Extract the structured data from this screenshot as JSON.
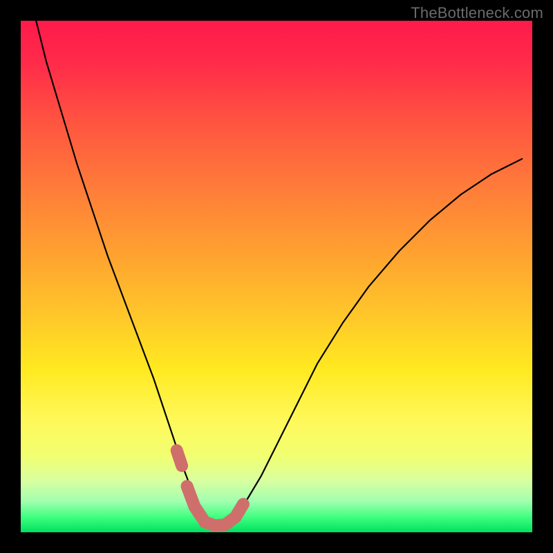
{
  "watermark": "TheBottleneck.com",
  "colors": {
    "frame_bg_top": "#ff1a4b",
    "frame_bg_bottom": "#00e060",
    "curve_stroke": "#000000",
    "marker_stroke": "#cf6f6c",
    "page_bg": "#000000"
  },
  "chart_data": {
    "type": "line",
    "title": "",
    "xlabel": "",
    "ylabel": "",
    "xlim": [
      0,
      100
    ],
    "ylim": [
      0,
      100
    ],
    "legend": false,
    "grid": false,
    "series": [
      {
        "name": "bottleneck-curve",
        "x": [
          3,
          5,
          8,
          11,
          14,
          17,
          20,
          23,
          26,
          28,
          30,
          32,
          33.5,
          35,
          36.5,
          38,
          40,
          42,
          44,
          47,
          50,
          54,
          58,
          63,
          68,
          74,
          80,
          86,
          92,
          98
        ],
        "values": [
          100,
          92,
          82,
          72,
          63,
          54,
          46,
          38,
          30,
          24,
          18,
          12,
          8,
          5,
          2.5,
          1.5,
          1.5,
          3,
          6,
          11,
          17,
          25,
          33,
          41,
          48,
          55,
          61,
          66,
          70,
          73
        ]
      }
    ],
    "markers": {
      "name": "highlight-band",
      "color": "#cf6f6c",
      "segments": [
        {
          "x": [
            30.5,
            31.5
          ],
          "values": [
            16,
            13
          ]
        },
        {
          "x": [
            32.5,
            34,
            36,
            38,
            40,
            42,
            43.5
          ],
          "values": [
            9,
            5,
            2,
            1.3,
            1.5,
            3,
            5.5
          ]
        }
      ],
      "dot": {
        "x": 30.5,
        "y": 16
      }
    }
  }
}
